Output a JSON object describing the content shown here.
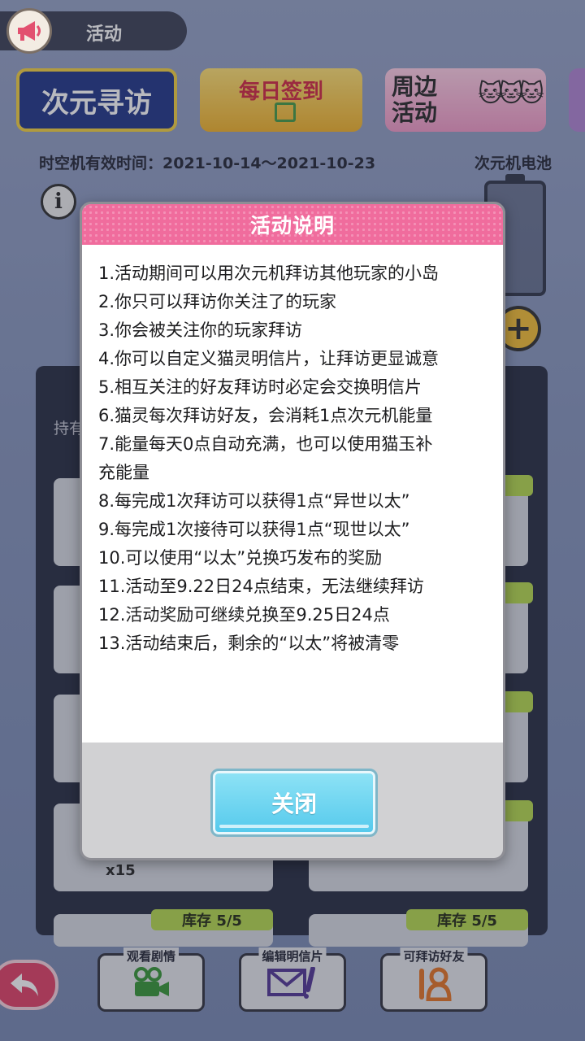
{
  "topbar": {
    "title": "活动"
  },
  "tabs": [
    {
      "label": "次元寻访"
    },
    {
      "label": "每日签到"
    },
    {
      "label": "周边活动"
    }
  ],
  "info": {
    "time_text": "时空机有效时间：2021-10-14～2021-10-23",
    "battery_label": "次元机电池",
    "info_glyph": "i",
    "plus_glyph": "+"
  },
  "background": {
    "hold_label": "持有",
    "stock_label_1": "库存 5/5",
    "stock_label_2": "库存 5/5",
    "count": "x15"
  },
  "bottom": {
    "watch_story": "观看剧情",
    "edit_postcard": "编辑明信片",
    "visitable_friends": "可拜访好友"
  },
  "modal": {
    "title": "活动说明",
    "rules": [
      "1.活动期间可以用次元机拜访其他玩家的小岛",
      "2.你只可以拜访你关注了的玩家",
      "3.你会被关注你的玩家拜访",
      "4.你可以自定义猫灵明信片，让拜访更显诚意",
      "5.相互关注的好友拜访时必定会交换明信片",
      "6.猫灵每次拜访好友，会消耗1点次元机能量",
      "7.能量每天0点自动充满，也可以使用猫玉补\n充能量",
      "8.每完成1次拜访可以获得1点“异世以太”",
      "9.每完成1次接待可以获得1点“现世以太”",
      "10.可以使用“以太”兑换巧发布的奖励",
      "11.活动至9.22日24点结束，无法继续拜访",
      "12.活动奖励可继续兑换至9.25日24点",
      "13.活动结束后，剩余的“以太”将被清零"
    ],
    "close_label": "关闭"
  }
}
